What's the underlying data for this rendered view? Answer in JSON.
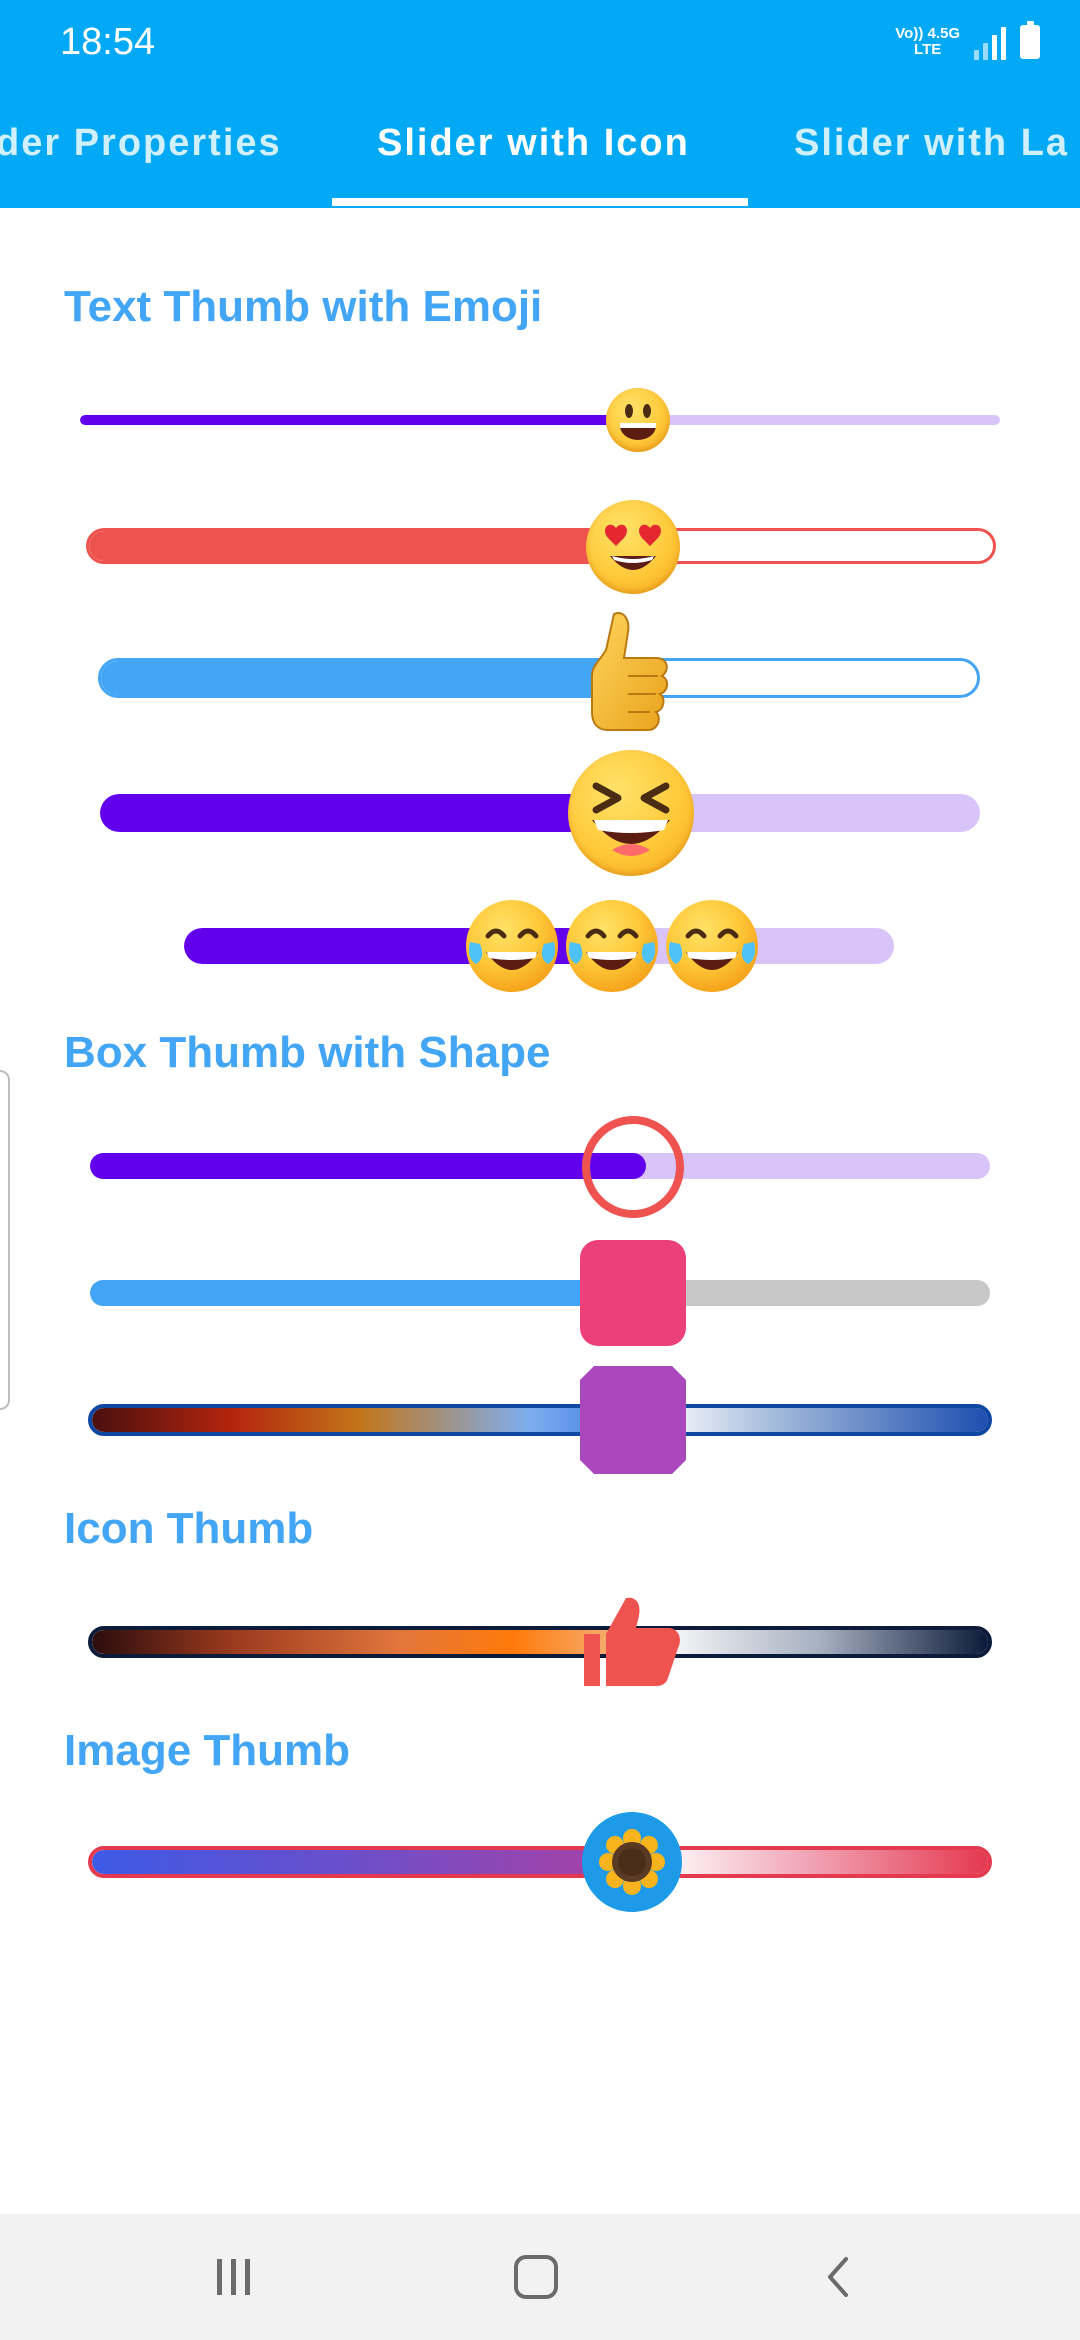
{
  "status_bar": {
    "time": "18:54",
    "network_top": "Vo)) 4.5G",
    "network_bottom": "LTE",
    "icons": [
      "signal-icon",
      "battery-icon"
    ]
  },
  "tabs": [
    {
      "label": "der Properties",
      "active": false
    },
    {
      "label": "Slider with Icon",
      "active": true
    },
    {
      "label": "Slider with La",
      "active": false
    }
  ],
  "colors": {
    "app_bar": "#03A9F4",
    "section_title": "#42A5F5",
    "purple": "#6200EE",
    "purple_light": "#D9C4FA",
    "red": "#EF5350",
    "blue": "#42A5F5",
    "pink": "#EC407A",
    "violet": "#AB47BC"
  },
  "sections": {
    "text_thumb": "Text Thumb with Emoji",
    "box_thumb": "Box Thumb with Shape",
    "icon_thumb": "Icon Thumb",
    "image_thumb": "Image Thumb"
  },
  "sliders": {
    "emoji_smile": {
      "value": 0.6,
      "thumb": "smiling-face-emoji"
    },
    "emoji_heart_eyes": {
      "value": 0.6,
      "thumb": "heart-eyes-emoji"
    },
    "emoji_thumbs_up": {
      "value": 0.6,
      "thumb": "thumbs-up-emoji"
    },
    "emoji_squint": {
      "value": 0.6,
      "thumb": "grinning-squint-emoji"
    },
    "emoji_triple": {
      "value": 0.6,
      "thumb": "tears-of-joy-emoji"
    },
    "box_ring": {
      "value": 0.6,
      "thumb": "ring-shape"
    },
    "box_rounded_square": {
      "value": 0.6,
      "thumb": "rounded-square-shape"
    },
    "box_octagon": {
      "value": 0.6,
      "thumb": "octagon-shape"
    },
    "icon_thumbs_up": {
      "value": 0.6,
      "thumb": "thumbs-up-icon"
    },
    "image_sunflower": {
      "value": 0.6,
      "thumb": "sunflower-image"
    }
  },
  "nav": [
    "recent-apps-icon",
    "home-icon",
    "back-icon"
  ]
}
